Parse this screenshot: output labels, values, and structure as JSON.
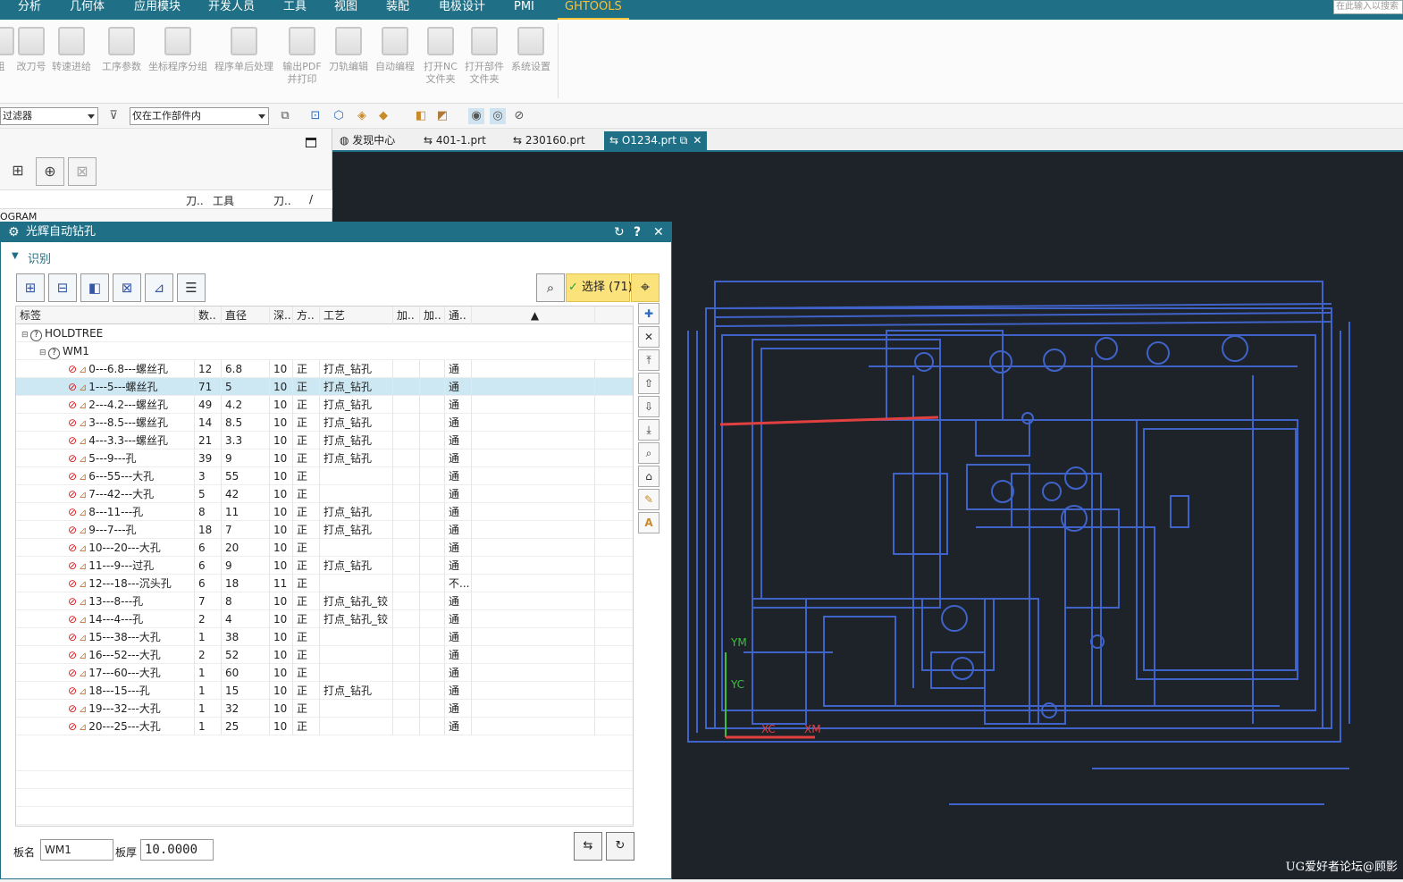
{
  "menu": {
    "items": [
      "分析",
      "几何体",
      "应用模块",
      "开发人员",
      "工具",
      "视图",
      "装配",
      "电极设计",
      "PMI",
      "GHTOOLS"
    ],
    "active": "GHTOOLS",
    "search_placeholder": "在此输入以搜索"
  },
  "ribbon": {
    "buttons": [
      {
        "label": "组",
        "icon": "group-icon"
      },
      {
        "label": "改刀号",
        "icon": "tool-number-icon"
      },
      {
        "label": "转速进给",
        "icon": "feed-speed-icon"
      },
      {
        "label": "工序参数",
        "icon": "operation-params-icon"
      },
      {
        "label": "坐标程序分组",
        "icon": "coordinate-group-icon"
      },
      {
        "label": "程序单后处理",
        "icon": "postprocess-icon"
      },
      {
        "label": "输出PDF\n并打印",
        "icon": "print-pdf-icon"
      },
      {
        "label": "刀轨编辑",
        "icon": "toolpath-edit-icon"
      },
      {
        "label": "自动编程",
        "icon": "auto-program-icon"
      },
      {
        "label": "打开NC\n文件夹",
        "icon": "folder-icon"
      },
      {
        "label": "打开部件\n文件夹",
        "icon": "part-folder-icon"
      },
      {
        "label": "系统设置",
        "icon": "settings-icon"
      }
    ]
  },
  "filterbar": {
    "filter_value": "过滤器",
    "scope_value": "仅在工作部件内"
  },
  "navigator": {
    "columns": [
      "刀..",
      "工具",
      "刀..",
      "/"
    ],
    "root_label": "OGRAM"
  },
  "tabs": [
    {
      "label": "发现中心",
      "icon": "discover-icon"
    },
    {
      "label": "401-1.prt",
      "icon": "part-icon"
    },
    {
      "label": "230160.prt",
      "icon": "part-icon"
    },
    {
      "label": "O1234.prt",
      "icon": "part-icon",
      "active": true
    }
  ],
  "dialog": {
    "title": "光辉自动钻孔",
    "section_title": "识别",
    "select_label": "选择 (71)",
    "columns": [
      "标签",
      "数..",
      "直径",
      "深..",
      "方..",
      "工艺",
      "加..",
      "加..",
      "通.."
    ],
    "tree_root": "HOLDTREE",
    "tree_child": "WM1",
    "rows": [
      {
        "label": "0---6.8---螺丝孔",
        "count": "12",
        "dia": "6.8",
        "depth": "10",
        "dir": "正",
        "process": "打点_钻孔",
        "through": "通"
      },
      {
        "label": "1---5---螺丝孔",
        "count": "71",
        "dia": "5",
        "depth": "10",
        "dir": "正",
        "process": "打点_钻孔",
        "through": "通",
        "selected": true
      },
      {
        "label": "2---4.2---螺丝孔",
        "count": "49",
        "dia": "4.2",
        "depth": "10",
        "dir": "正",
        "process": "打点_钻孔",
        "through": "通"
      },
      {
        "label": "3---8.5---螺丝孔",
        "count": "14",
        "dia": "8.5",
        "depth": "10",
        "dir": "正",
        "process": "打点_钻孔",
        "through": "通"
      },
      {
        "label": "4---3.3---螺丝孔",
        "count": "21",
        "dia": "3.3",
        "depth": "10",
        "dir": "正",
        "process": "打点_钻孔",
        "through": "通"
      },
      {
        "label": "5---9---孔",
        "count": "39",
        "dia": "9",
        "depth": "10",
        "dir": "正",
        "process": "打点_钻孔",
        "through": "通"
      },
      {
        "label": "6---55---大孔",
        "count": "3",
        "dia": "55",
        "depth": "10",
        "dir": "正",
        "process": "",
        "through": "通"
      },
      {
        "label": "7---42---大孔",
        "count": "5",
        "dia": "42",
        "depth": "10",
        "dir": "正",
        "process": "",
        "through": "通"
      },
      {
        "label": "8---11---孔",
        "count": "8",
        "dia": "11",
        "depth": "10",
        "dir": "正",
        "process": "打点_钻孔",
        "through": "通"
      },
      {
        "label": "9---7---孔",
        "count": "18",
        "dia": "7",
        "depth": "10",
        "dir": "正",
        "process": "打点_钻孔",
        "through": "通"
      },
      {
        "label": "10---20---大孔",
        "count": "6",
        "dia": "20",
        "depth": "10",
        "dir": "正",
        "process": "",
        "through": "通"
      },
      {
        "label": "11---9---过孔",
        "count": "6",
        "dia": "9",
        "depth": "10",
        "dir": "正",
        "process": "打点_钻孔",
        "through": "通"
      },
      {
        "label": "12---18---沉头孔",
        "count": "6",
        "dia": "18",
        "depth": "11",
        "dir": "正",
        "process": "",
        "through": "不..."
      },
      {
        "label": "13---8---孔",
        "count": "7",
        "dia": "8",
        "depth": "10",
        "dir": "正",
        "process": "打点_钻孔_铰",
        "through": "通"
      },
      {
        "label": "14---4---孔",
        "count": "2",
        "dia": "4",
        "depth": "10",
        "dir": "正",
        "process": "打点_钻孔_铰",
        "through": "通"
      },
      {
        "label": "15---38---大孔",
        "count": "1",
        "dia": "38",
        "depth": "10",
        "dir": "正",
        "process": "",
        "through": "通"
      },
      {
        "label": "16---52---大孔",
        "count": "2",
        "dia": "52",
        "depth": "10",
        "dir": "正",
        "process": "",
        "through": "通"
      },
      {
        "label": "17---60---大孔",
        "count": "1",
        "dia": "60",
        "depth": "10",
        "dir": "正",
        "process": "",
        "through": "通"
      },
      {
        "label": "18---15---孔",
        "count": "1",
        "dia": "15",
        "depth": "10",
        "dir": "正",
        "process": "打点_钻孔",
        "through": "通"
      },
      {
        "label": "19---32---大孔",
        "count": "1",
        "dia": "32",
        "depth": "10",
        "dir": "正",
        "process": "",
        "through": "通"
      },
      {
        "label": "20---25---大孔",
        "count": "1",
        "dia": "25",
        "depth": "10",
        "dir": "正",
        "process": "",
        "through": "通"
      }
    ],
    "plate_name_label": "板名",
    "plate_name_value": "WM1",
    "plate_thickness_label": "板厚",
    "plate_thickness_value": "10.0000"
  },
  "graphics": {
    "axis_labels": {
      "ym": "YM",
      "yc": "YC",
      "xc": "XC",
      "xm": "XM"
    },
    "wire_color": "#3f63c9",
    "highlight_color": "#e04040"
  },
  "watermark": "UG爱好者论坛@顾影"
}
